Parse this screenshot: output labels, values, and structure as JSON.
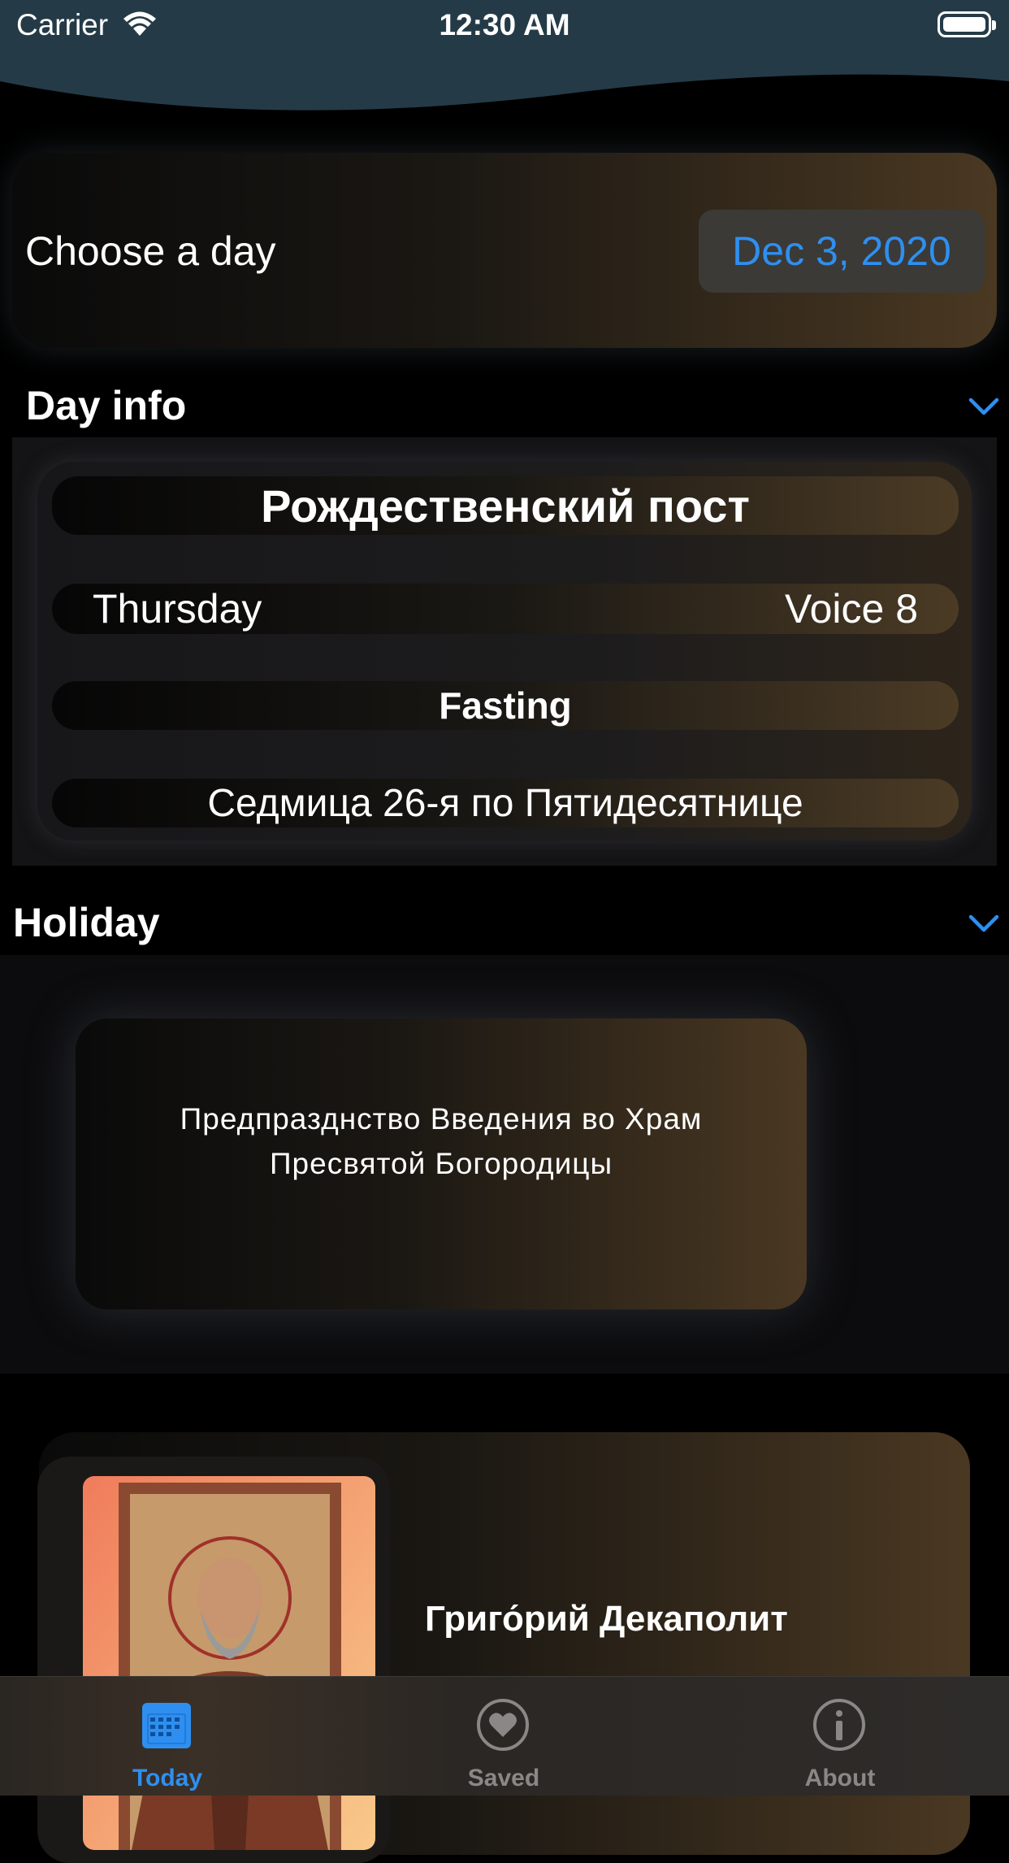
{
  "status_bar": {
    "carrier": "Carrier",
    "time": "12:30 AM"
  },
  "date_picker": {
    "label": "Choose a day",
    "value": "Dec 3, 2020"
  },
  "day_info": {
    "title": "Day info",
    "fast_name": "Рождественский пост",
    "weekday": "Thursday",
    "voice": "Voice 8",
    "fasting": "Fasting",
    "week": "Седмица 26-я по Пятидесятнице"
  },
  "holiday": {
    "title": "Holiday",
    "text": "Предпразднство Введения во Храм Пресвятой Богородицы"
  },
  "saint": {
    "name": "Григо́рий Декаполит"
  },
  "tabbar": {
    "tabs": [
      {
        "label": "Today",
        "icon": "calendar-icon",
        "active": true
      },
      {
        "label": "Saved",
        "icon": "heart-icon",
        "active": false
      },
      {
        "label": "About",
        "icon": "info-icon",
        "active": false
      }
    ]
  },
  "colors": {
    "accent": "#2e8ff0",
    "inactive": "#8a8886"
  }
}
